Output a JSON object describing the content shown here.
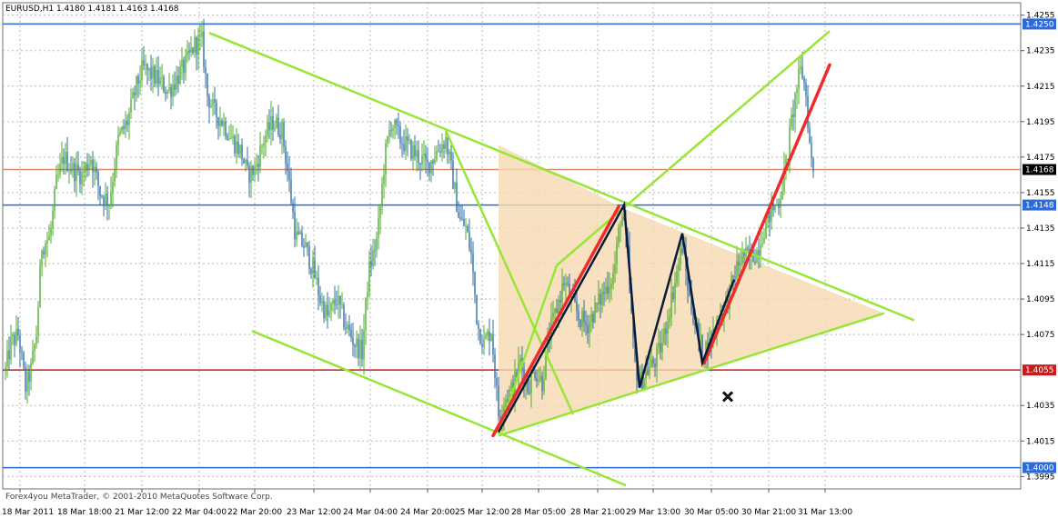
{
  "header": {
    "symbol_text": "EURUSD,H1  1.4180 1.4181 1.4163 1.4168"
  },
  "footer": {
    "copyright": "Forex4you MetaTrader, © 2001-2010 MetaQuotes Software Corp."
  },
  "colors": {
    "bull": "#4caf2b",
    "bear": "#2f6fa8",
    "trend_green": "#97e636",
    "red_trend": "#ef2b2b",
    "zigzag": "#0b1a3a",
    "triangle_fill": "#f6d9b0",
    "blue_level": "#2b6ad8",
    "red_level": "#c21e1e",
    "light_red_level": "#e08a72"
  },
  "chart_data": {
    "type": "candlestick",
    "symbol": "EURUSD",
    "timeframe": "H1",
    "ohlc_current": {
      "open": 1.418,
      "high": 1.4181,
      "low": 1.4163,
      "close": 1.4168
    },
    "ylim": [
      1.3988,
      1.4262
    ],
    "price_ticks": [
      "1.4255",
      "1.4235",
      "1.4215",
      "1.4195",
      "1.4175",
      "1.4155",
      "1.4135",
      "1.4115",
      "1.4095",
      "1.4075",
      "1.4035",
      "1.4015",
      "1.3995"
    ],
    "date_labels": [
      "18 Mar 2011",
      "18 Mar 18:00",
      "21 Mar 12:00",
      "22 Mar 04:00",
      "22 Mar 20:00",
      "23 Mar 12:00",
      "24 Mar 04:00",
      "24 Mar 20:00",
      "25 Mar 12:00",
      "28 Mar 05:00",
      "28 Mar 21:00",
      "29 Mar 13:00",
      "30 Mar 05:00",
      "30 Mar 21:00",
      "31 Mar 13:00"
    ],
    "date_label_x": [
      22,
      93,
      156,
      219,
      280,
      345,
      407,
      470,
      530,
      592,
      657,
      718,
      782,
      845,
      907
    ],
    "levels": [
      {
        "price": 1.425,
        "label": "1.4250",
        "kind": "blue"
      },
      {
        "price": 1.4168,
        "label": "1.4168",
        "kind": "current"
      },
      {
        "price": 1.4148,
        "label": "1.4148",
        "kind": "blue"
      },
      {
        "price": 1.4055,
        "label": "1.4055",
        "kind": "red"
      },
      {
        "price": 1.4,
        "label": "1.4000",
        "kind": "blue"
      }
    ],
    "price_path": [
      [
        6,
        1.4055
      ],
      [
        12,
        1.407
      ],
      [
        20,
        1.4075
      ],
      [
        28,
        1.4045
      ],
      [
        34,
        1.4055
      ],
      [
        40,
        1.4075
      ],
      [
        46,
        1.4125
      ],
      [
        55,
        1.413
      ],
      [
        62,
        1.416
      ],
      [
        70,
        1.4175
      ],
      [
        80,
        1.4168
      ],
      [
        90,
        1.4165
      ],
      [
        100,
        1.4175
      ],
      [
        110,
        1.4155
      ],
      [
        120,
        1.415
      ],
      [
        130,
        1.4185
      ],
      [
        140,
        1.4195
      ],
      [
        150,
        1.4215
      ],
      [
        157,
        1.4225
      ],
      [
        165,
        1.4222
      ],
      [
        175,
        1.4218
      ],
      [
        185,
        1.4212
      ],
      [
        195,
        1.422
      ],
      [
        205,
        1.4228
      ],
      [
        213,
        1.4238
      ],
      [
        222,
        1.424
      ],
      [
        228,
        1.421
      ],
      [
        236,
        1.42
      ],
      [
        245,
        1.4195
      ],
      [
        255,
        1.4185
      ],
      [
        265,
        1.4178
      ],
      [
        272,
        1.4165
      ],
      [
        280,
        1.4168
      ],
      [
        290,
        1.4185
      ],
      [
        300,
        1.4195
      ],
      [
        310,
        1.419
      ],
      [
        318,
        1.416
      ],
      [
        325,
        1.413
      ],
      [
        335,
        1.4125
      ],
      [
        345,
        1.411
      ],
      [
        352,
        1.4095
      ],
      [
        360,
        1.4085
      ],
      [
        370,
        1.4095
      ],
      [
        380,
        1.408
      ],
      [
        390,
        1.407
      ],
      [
        398,
        1.4065
      ],
      [
        405,
        1.411
      ],
      [
        415,
        1.413
      ],
      [
        423,
        1.4175
      ],
      [
        430,
        1.4195
      ],
      [
        440,
        1.4185
      ],
      [
        450,
        1.418
      ],
      [
        460,
        1.4175
      ],
      [
        470,
        1.417
      ],
      [
        480,
        1.4178
      ],
      [
        490,
        1.4185
      ],
      [
        497,
        1.4165
      ],
      [
        505,
        1.414
      ],
      [
        512,
        1.4135
      ],
      [
        518,
        1.412
      ],
      [
        525,
        1.408
      ],
      [
        532,
        1.407
      ],
      [
        540,
        1.4078
      ],
      [
        548,
        1.403
      ],
      [
        556,
        1.404
      ],
      [
        564,
        1.4045
      ],
      [
        572,
        1.406
      ],
      [
        580,
        1.4045
      ],
      [
        588,
        1.4055
      ],
      [
        596,
        1.4048
      ],
      [
        604,
        1.4075
      ],
      [
        612,
        1.409
      ],
      [
        620,
        1.4105
      ],
      [
        628,
        1.4095
      ],
      [
        636,
        1.4085
      ],
      [
        645,
        1.408
      ],
      [
        655,
        1.409
      ],
      [
        665,
        1.41
      ],
      [
        675,
        1.411
      ],
      [
        683,
        1.4145
      ],
      [
        690,
        1.412
      ],
      [
        697,
        1.406
      ],
      [
        703,
        1.4048
      ],
      [
        712,
        1.4055
      ],
      [
        720,
        1.406
      ],
      [
        728,
        1.407
      ],
      [
        736,
        1.409
      ],
      [
        744,
        1.411
      ],
      [
        750,
        1.4125
      ],
      [
        758,
        1.4095
      ],
      [
        765,
        1.408
      ],
      [
        772,
        1.4065
      ],
      [
        780,
        1.407
      ],
      [
        790,
        1.4085
      ],
      [
        800,
        1.4095
      ],
      [
        808,
        1.411
      ],
      [
        816,
        1.412
      ],
      [
        824,
        1.4118
      ],
      [
        832,
        1.4122
      ],
      [
        840,
        1.4135
      ],
      [
        848,
        1.4145
      ],
      [
        856,
        1.415
      ],
      [
        864,
        1.417
      ],
      [
        870,
        1.4195
      ],
      [
        876,
        1.4215
      ],
      [
        881,
        1.4225
      ],
      [
        886,
        1.421
      ],
      [
        891,
        1.4175
      ],
      [
        894,
        1.4168
      ]
    ],
    "annotations": {
      "triangle_shade": [
        [
          548,
          1.4182
        ],
        [
          686,
          1.4146
        ],
        [
          972,
          1.4087
        ],
        [
          548,
          1.4018
        ]
      ],
      "green_lines": [
        {
          "name": "upper-downtrend-line",
          "p1": [
            230,
            1.4245
          ],
          "p2": [
            1005,
            1.4083
          ]
        },
        {
          "name": "lower-downtrend-line",
          "p1": [
            277,
            1.4077
          ],
          "p2": [
            688,
            1.399
          ]
        },
        {
          "name": "triangle-lower-line",
          "p1": [
            548,
            1.4018
          ],
          "p2": [
            972,
            1.4087
          ]
        },
        {
          "name": "upward-channel-line",
          "p1": [
            612,
            1.4114
          ],
          "p2": [
            912,
            1.4246
          ]
        },
        {
          "name": "drop-line",
          "p1": [
            490,
            1.419
          ],
          "p2": [
            630,
            1.403
          ]
        },
        {
          "name": "short-retrace-line",
          "p1": [
            548,
            1.402
          ],
          "p2": [
            612,
            1.4114
          ]
        }
      ],
      "red_lines": [
        {
          "name": "red-trend-line-1",
          "p1": [
            542,
            1.4018
          ],
          "p2": [
            680,
            1.4147
          ]
        },
        {
          "name": "red-trend-line-2",
          "p1": [
            774,
            1.4059
          ],
          "p2": [
            912,
            1.4227
          ]
        }
      ],
      "zigzag": [
        [
          548,
          1.402
        ],
        [
          686,
          1.4148
        ],
        [
          703,
          1.4045
        ],
        [
          750,
          1.4132
        ],
        [
          772,
          1.4059
        ],
        [
          807,
          1.4106
        ]
      ],
      "cross_marker": [
        800,
        1.404
      ]
    }
  }
}
